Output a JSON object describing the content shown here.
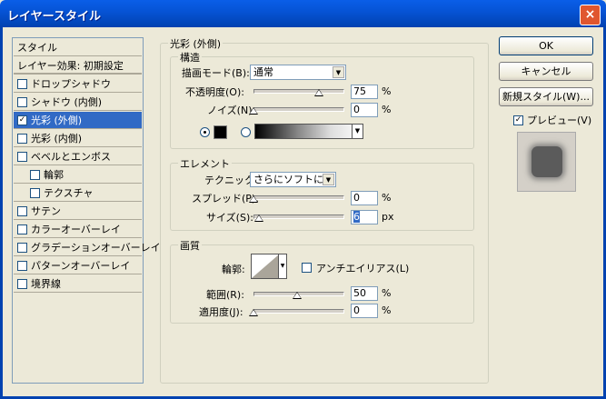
{
  "window": {
    "title": "レイヤースタイル",
    "close": "×"
  },
  "sidebar": {
    "items": [
      {
        "label": "スタイル",
        "checkbox": false
      },
      {
        "label": "レイヤー効果: 初期設定",
        "checkbox": false
      },
      {
        "label": "ドロップシャドウ",
        "checkbox": true,
        "checked": false
      },
      {
        "label": "シャドウ (内側)",
        "checkbox": true,
        "checked": false
      },
      {
        "label": "光彩 (外側)",
        "checkbox": true,
        "checked": true,
        "selected": true
      },
      {
        "label": "光彩 (内側)",
        "checkbox": true,
        "checked": false
      },
      {
        "label": "ベベルとエンボス",
        "checkbox": true,
        "checked": false
      },
      {
        "label": "輪郭",
        "checkbox": true,
        "checked": false,
        "indent": true
      },
      {
        "label": "テクスチャ",
        "checkbox": true,
        "checked": false,
        "indent": true
      },
      {
        "label": "サテン",
        "checkbox": true,
        "checked": false
      },
      {
        "label": "カラーオーバーレイ",
        "checkbox": true,
        "checked": false
      },
      {
        "label": "グラデーションオーバーレイ",
        "checkbox": true,
        "checked": false
      },
      {
        "label": "パターンオーバーレイ",
        "checkbox": true,
        "checked": false
      },
      {
        "label": "境界線",
        "checkbox": true,
        "checked": false
      }
    ]
  },
  "outer_glow": {
    "title": "光彩 (外側)",
    "structure": {
      "title": "構造",
      "blend_mode_label": "描画モード(B):",
      "blend_mode_value": "通常",
      "opacity_label": "不透明度(O):",
      "opacity_value": "75",
      "opacity_unit": "%",
      "noise_label": "ノイズ(N):",
      "noise_value": "0",
      "noise_unit": "%"
    },
    "elements": {
      "title": "エレメント",
      "technique_label": "テクニック:",
      "technique_value": "さらにソフトに",
      "spread_label": "スプレッド(P):",
      "spread_value": "0",
      "spread_unit": "%",
      "size_label": "サイズ(S):",
      "size_value": "6",
      "size_unit": "px"
    },
    "quality": {
      "title": "画質",
      "contour_label": "輪郭:",
      "antialias_label": "アンチエイリアス(L)",
      "range_label": "範囲(R):",
      "range_value": "50",
      "range_unit": "%",
      "jitter_label": "適用度(J):",
      "jitter_value": "0",
      "jitter_unit": "%"
    }
  },
  "buttons": {
    "ok": "OK",
    "cancel": "キャンセル",
    "new_style": "新規スタイル(W)...",
    "preview_label": "プレビュー(V)",
    "preview_checked": true
  },
  "slider_levels": {
    "opacity": 0.75,
    "noise": 0,
    "spread": 0,
    "size": 0.06,
    "range": 0.5,
    "jitter": 0
  },
  "colors": {
    "accent": "#316ac5",
    "titlebar": "#0654d6",
    "glow_swatch": "#000000"
  }
}
